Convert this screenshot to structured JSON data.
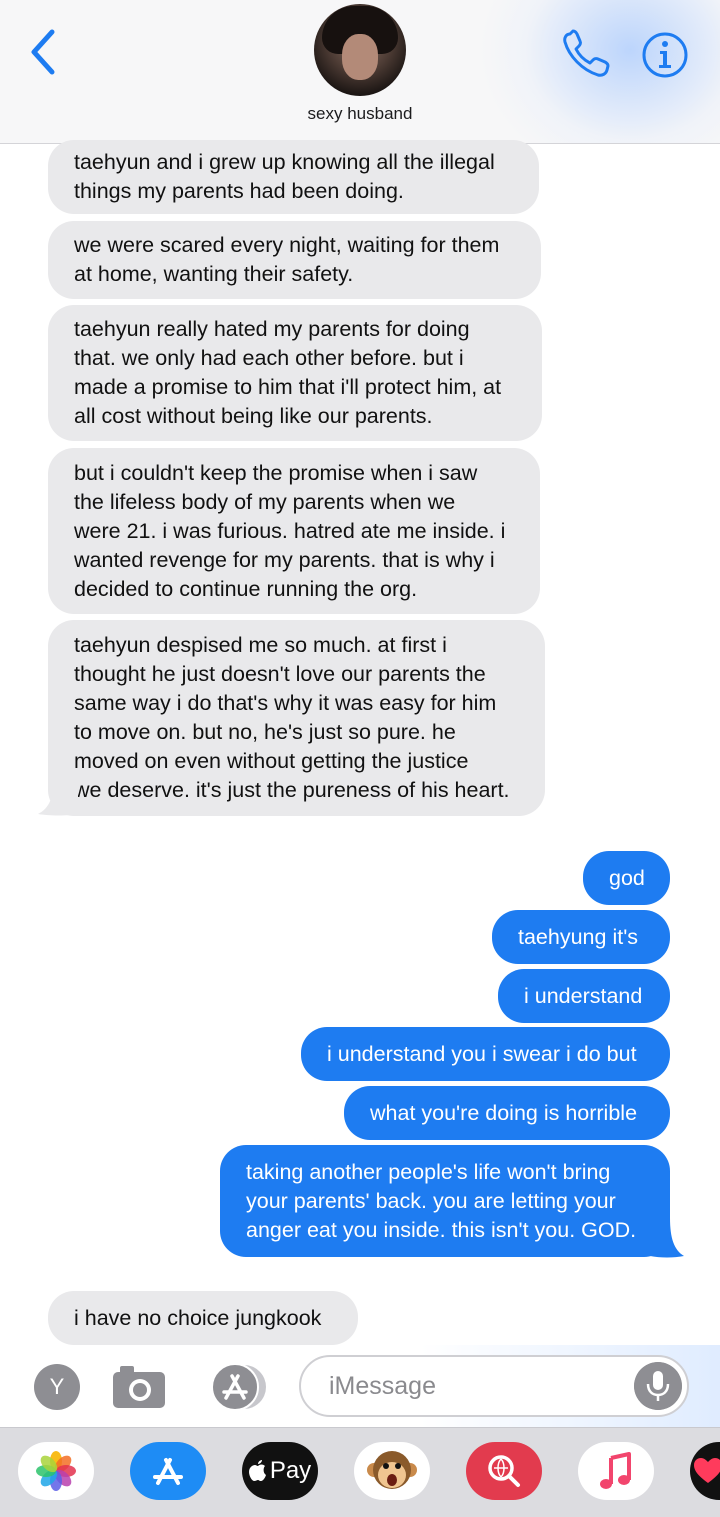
{
  "header": {
    "contact_name": "sexy husband"
  },
  "messages": [
    {
      "direction": "received",
      "text": "taehyun and i grew up knowing all the illegal\nthings my parents had been doing."
    },
    {
      "direction": "received",
      "text": "we were scared every night, waiting for them\nat home, wanting their safety."
    },
    {
      "direction": "received",
      "text": "taehyun really hated my parents for doing\nthat. we only had each other before. but i\nmade a promise to him that i'll protect him, at\nall cost without being like our parents."
    },
    {
      "direction": "received",
      "text": "but i couldn't keep the promise when i saw\nthe lifeless body of my parents when we\nwere 21. i was furious. hatred ate me inside. i\nwanted revenge for my parents. that is why i\ndecided to continue running the org."
    },
    {
      "direction": "received",
      "text": "taehyun despised me so much. at first i\nthought he just doesn't love our parents the\nsame way i do that's why it was easy for him\nto move on. but no, he's just so pure. he\nmoved on even without getting the justice\nwe deserve. it's just the pureness of his heart."
    },
    {
      "direction": "sent",
      "text": "god"
    },
    {
      "direction": "sent",
      "text": "taehyung it's"
    },
    {
      "direction": "sent",
      "text": "i understand"
    },
    {
      "direction": "sent",
      "text": "i understand you i swear i do but"
    },
    {
      "direction": "sent",
      "text": "what you're doing is horrible"
    },
    {
      "direction": "sent",
      "text": "taking another people's life won't bring\nyour parents' back. you are letting your\nanger eat you inside. this isn't you. GOD."
    },
    {
      "direction": "received",
      "text": "i have no choice jungkook"
    }
  ],
  "input_bar": {
    "avatar_letter": "Y",
    "placeholder": "iMessage"
  },
  "app_drawer": {
    "apps": [
      {
        "icon": "photos-icon"
      },
      {
        "icon": "app-store-icon"
      },
      {
        "icon": "apple-pay-icon",
        "label": "Pay"
      },
      {
        "icon": "monkey-animoji-icon"
      },
      {
        "icon": "web-search-icon"
      },
      {
        "icon": "music-icon"
      },
      {
        "icon": "heart-icon"
      }
    ]
  },
  "colors": {
    "accent": "#1e7cf1",
    "received_bubble": "#e9e9eb",
    "sent_bubble": "#1e7cf1"
  }
}
